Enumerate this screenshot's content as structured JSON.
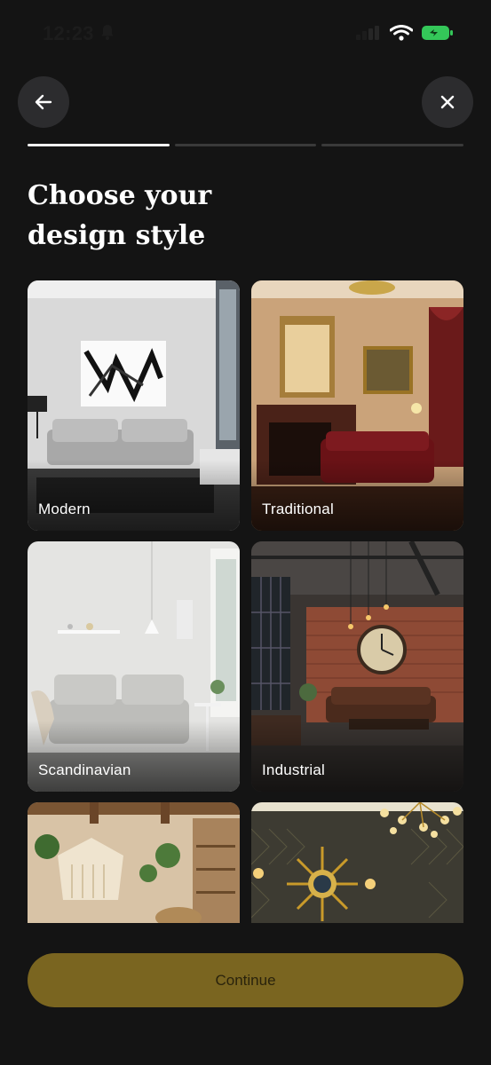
{
  "status_bar": {
    "time": "12:23"
  },
  "nav": {
    "back_icon": "arrow-left-icon",
    "close_icon": "close-icon"
  },
  "progress": {
    "steps": 3,
    "current": 1
  },
  "title": "Choose your design style",
  "styles": [
    {
      "label": "Modern"
    },
    {
      "label": "Traditional"
    },
    {
      "label": "Scandinavian"
    },
    {
      "label": "Industrial"
    },
    {
      "label": ""
    },
    {
      "label": ""
    }
  ],
  "continue_label": "Continue",
  "colors": {
    "background": "#141414",
    "accent": "#7a6520",
    "surface": "#2c2c2e"
  }
}
